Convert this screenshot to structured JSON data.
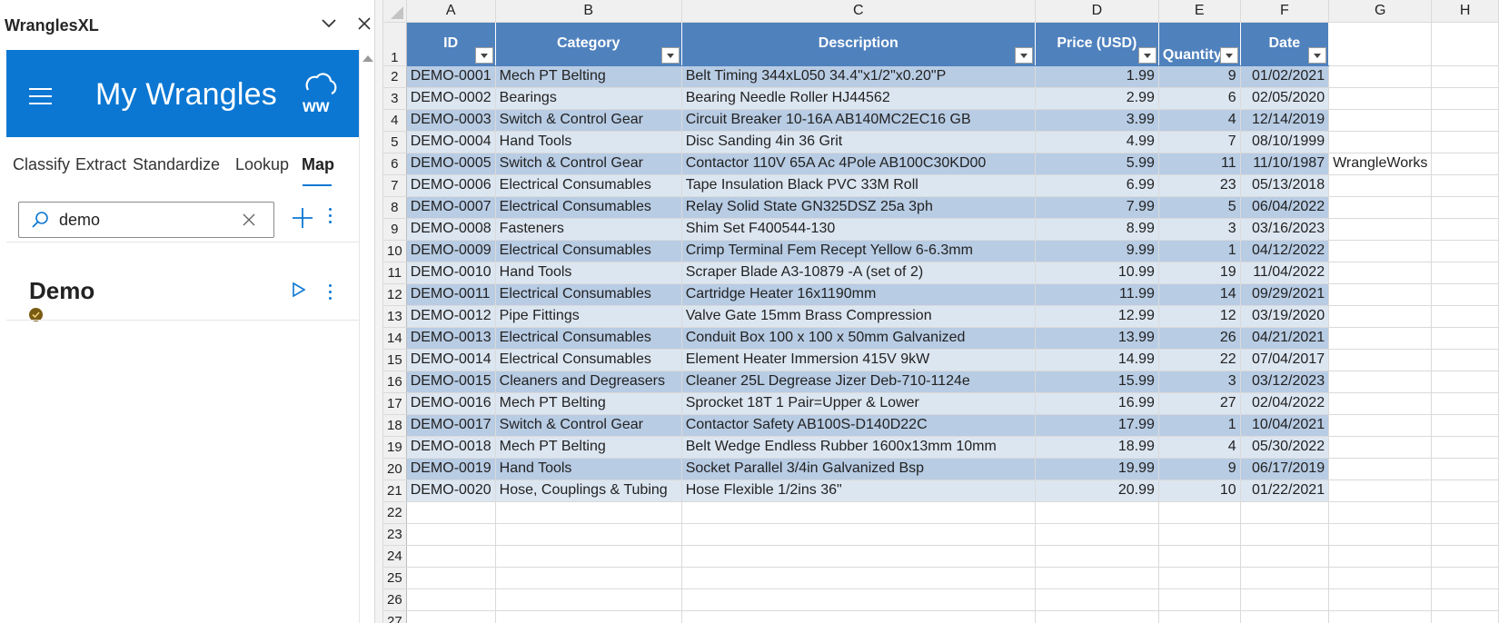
{
  "pane": {
    "title": "WranglesXL",
    "hero_title": "My Wrangles",
    "tabs": [
      "Classify",
      "Extract",
      "Standardize",
      "Lookup",
      "Map"
    ],
    "active_tab": "Map",
    "search": {
      "value": "demo",
      "placeholder": ""
    },
    "wrangles": [
      {
        "name": "Demo",
        "status": "verified"
      }
    ],
    "icons": [
      "hamburger-icon",
      "ww-logo-icon",
      "search-icon",
      "clear-icon",
      "plus-icon",
      "more-icon",
      "play-icon",
      "chevron-down-icon",
      "close-icon"
    ],
    "accent_color": "#0b77d3"
  },
  "sheet": {
    "columns": [
      "A",
      "B",
      "C",
      "D",
      "E",
      "F",
      "G",
      "H"
    ],
    "headers": [
      "ID",
      "Category",
      "Description",
      "Price (USD)",
      "Quantity",
      "Date"
    ],
    "header_color": "#4f81bd",
    "band_colors": [
      "#b8cce4",
      "#dce6f1"
    ],
    "rows": [
      [
        "DEMO-0001",
        "Mech PT Belting",
        "Belt Timing 344xL050 34.4\"x1/2\"x0.20\"P",
        "1.99",
        "9",
        "01/02/2021"
      ],
      [
        "DEMO-0002",
        "Bearings",
        "Bearing Needle Roller HJ44562",
        "2.99",
        "6",
        "02/05/2020"
      ],
      [
        "DEMO-0003",
        "Switch & Control Gear",
        "Circuit Breaker 10-16A AB140MC2EC16 GB",
        "3.99",
        "4",
        "12/14/2019"
      ],
      [
        "DEMO-0004",
        "Hand Tools",
        "Disc Sanding 4in 36 Grit",
        "4.99",
        "7",
        "08/10/1999"
      ],
      [
        "DEMO-0005",
        "Switch & Control Gear",
        "Contactor 110V 65A Ac 4Pole AB100C30KD00",
        "5.99",
        "11",
        "11/10/1987"
      ],
      [
        "DEMO-0006",
        "Electrical Consumables",
        "Tape Insulation Black PVC 33M Roll",
        "6.99",
        "23",
        "05/13/2018"
      ],
      [
        "DEMO-0007",
        "Electrical Consumables",
        "Relay Solid State GN325DSZ 25a 3ph",
        "7.99",
        "5",
        "06/04/2022"
      ],
      [
        "DEMO-0008",
        "Fasteners",
        "Shim Set F400544-130",
        "8.99",
        "3",
        "03/16/2023"
      ],
      [
        "DEMO-0009",
        "Electrical Consumables",
        "Crimp Terminal Fem Recept Yellow 6-6.3mm",
        "9.99",
        "1",
        "04/12/2022"
      ],
      [
        "DEMO-0010",
        "Hand Tools",
        "Scraper Blade A3-10879 -A (set of 2)",
        "10.99",
        "19",
        "11/04/2022"
      ],
      [
        "DEMO-0011",
        "Electrical Consumables",
        "Cartridge Heater 16x1190mm",
        "11.99",
        "14",
        "09/29/2021"
      ],
      [
        "DEMO-0012",
        "Pipe Fittings",
        "Valve Gate 15mm Brass Compression",
        "12.99",
        "12",
        "03/19/2020"
      ],
      [
        "DEMO-0013",
        "Electrical Consumables",
        "Conduit Box 100 x 100 x 50mm Galvanized",
        "13.99",
        "26",
        "04/21/2021"
      ],
      [
        "DEMO-0014",
        "Electrical Consumables",
        "Element Heater Immersion 415V 9kW",
        "14.99",
        "22",
        "07/04/2017"
      ],
      [
        "DEMO-0015",
        "Cleaners and Degreasers",
        "Cleaner 25L Degrease Jizer Deb-710-1124e",
        "15.99",
        "3",
        "03/12/2023"
      ],
      [
        "DEMO-0016",
        "Mech PT Belting",
        "Sprocket 18T 1 Pair=Upper & Lower",
        "16.99",
        "27",
        "02/04/2022"
      ],
      [
        "DEMO-0017",
        "Switch & Control Gear",
        "Contactor Safety AB100S-D140D22C",
        "17.99",
        "1",
        "10/04/2021"
      ],
      [
        "DEMO-0018",
        "Mech PT Belting",
        "Belt Wedge Endless Rubber 1600x13mm 10mm",
        "18.99",
        "4",
        "05/30/2022"
      ],
      [
        "DEMO-0019",
        "Hand Tools",
        "Socket Parallel 3/4in Galvanized Bsp",
        "19.99",
        "9",
        "06/17/2019"
      ],
      [
        "DEMO-0020",
        "Hose, Couplings & Tubing",
        "Hose Flexible 1/2ins 36\"",
        "20.99",
        "10",
        "01/22/2021"
      ]
    ],
    "extra_cell_g6": "WrangleWorks",
    "empty_rows": [
      "22",
      "23",
      "24",
      "25",
      "26",
      "27"
    ]
  }
}
